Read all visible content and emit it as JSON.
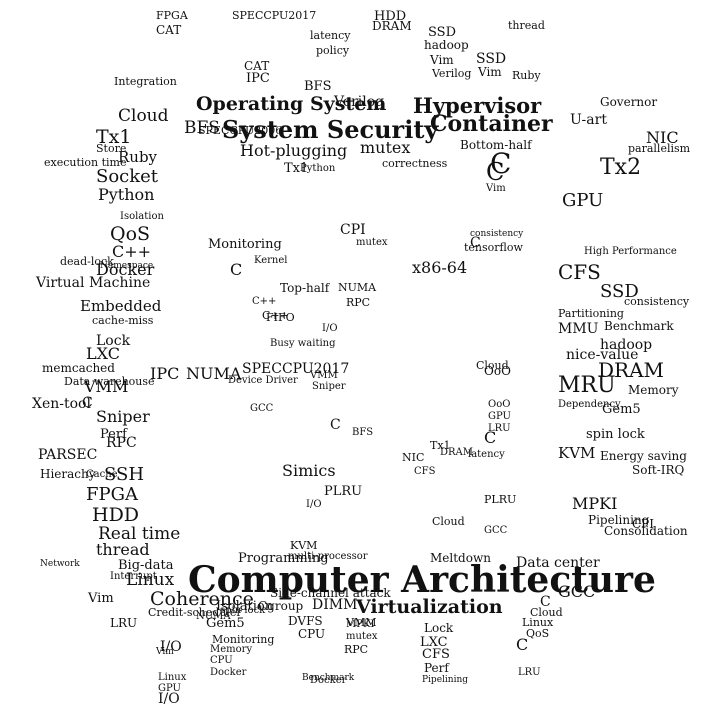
{
  "word_cloud": {
    "words": [
      "Computer Architecture",
      "System Security",
      "Operating System",
      "Hypervisor",
      "Container",
      "Virtualization",
      "Linux",
      "Coherence",
      "Programming",
      "Hot-plugging",
      "mutex",
      "Socket",
      "Python",
      "QoS",
      "Docker",
      "Virtual Machine",
      "Embedded",
      "Lock",
      "LXC",
      "VMM",
      "Sniper",
      "PARSEC",
      "FPGA",
      "HDD",
      "Real time",
      "thread",
      "Big-data",
      "SSH",
      "Simics",
      "NUMA",
      "SPECCPU2017",
      "IPC",
      "MRU",
      "DRAM",
      "nice-value",
      "KVM",
      "Energy saving",
      "Soft-IRQ",
      "MPKI",
      "Data center",
      "GCC",
      "CFS",
      "SSD",
      "hadoop",
      "MMU",
      "Benchmark",
      "Partitioning",
      "consistency",
      "GPU",
      "Tx2",
      "Tx1",
      "NIC",
      "Cloud",
      "BFS",
      "Ruby",
      "C++",
      "Vim",
      "RPC",
      "Perf",
      "x86-64",
      "CPI",
      "Top-half",
      "Bottom-half",
      "U-art",
      "Verilog",
      "tensorflow",
      "Memory",
      "DVFS",
      "CPU",
      "Cgroup",
      "Side-channel attack",
      "Meltdown",
      "Gem5",
      "Cache",
      "Xen-tool",
      "memcached",
      "dead-lock",
      "execution time",
      "spin lock",
      "Pipelining",
      "parallelism",
      "FIFO",
      "OoO",
      "LRU",
      "PLRU",
      "C",
      "I/O",
      "CAT",
      "Isolation",
      "Governor",
      "Monitoring",
      "SPECCPU2006",
      "High Performance",
      "cache-miss",
      "correctness",
      "Interrupt",
      "Namespace",
      "Network",
      "Store",
      "Dependency",
      "Data warehouse",
      "Hierachy",
      "Credit-scheduler",
      "Consolidation",
      "Busy waiting",
      "Kernel",
      "Integration",
      "policy",
      "latency",
      "multi-processor",
      "Device Driver",
      "DIMM"
    ]
  }
}
